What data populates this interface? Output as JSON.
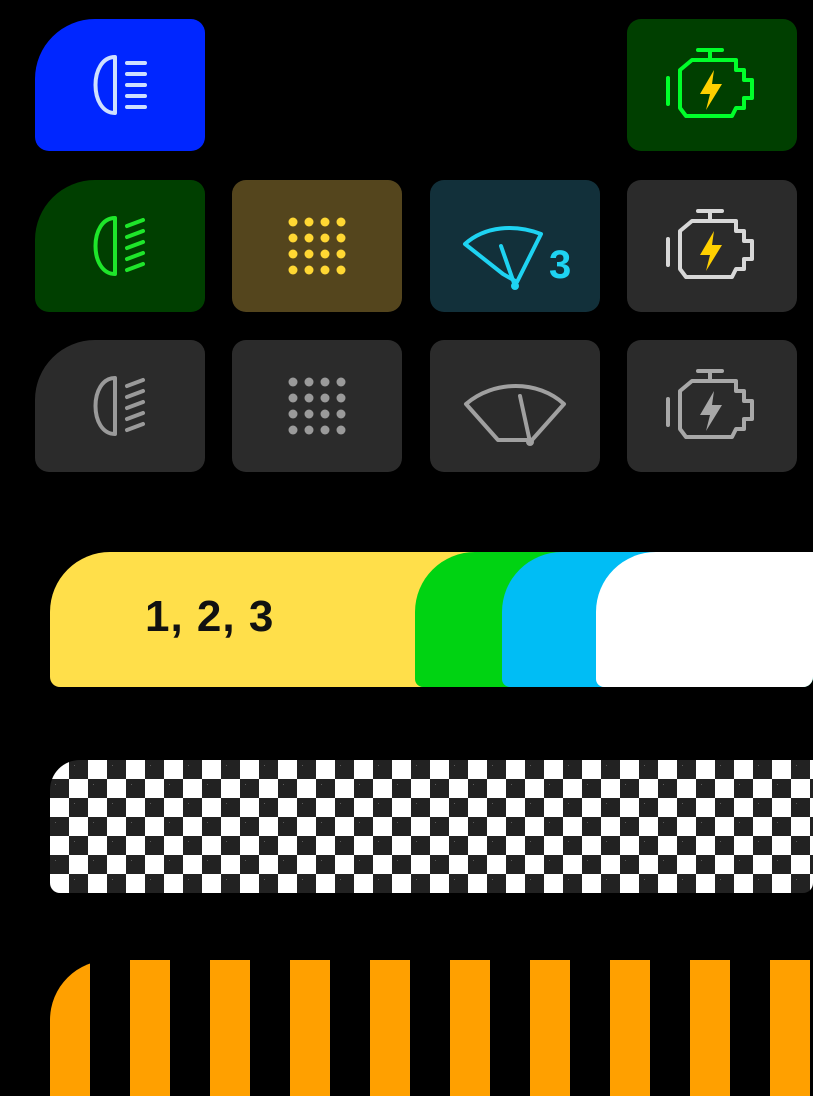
{
  "icons": {
    "row1": [
      {
        "name": "low-beam-headlight-icon",
        "bg": "#0026ff",
        "stroke": "#cfe0ff"
      },
      {
        "name": "check-engine-icon",
        "bg": "#003f00",
        "stroke": "#00ff2a",
        "bolt": "#ffd000"
      }
    ],
    "row2": [
      {
        "name": "fog-light-icon",
        "bg": "#003f00",
        "stroke": "#1ee62a"
      },
      {
        "name": "dot-grid-icon",
        "bg": "#54451d",
        "stroke": "#ffd733"
      },
      {
        "name": "wiper-icon",
        "bg": "#12303a",
        "stroke": "#1ed3f2",
        "badge": "3"
      },
      {
        "name": "check-engine-icon",
        "bg": "#2b2b2b",
        "stroke": "#d8d8d8",
        "bolt": "#ffd000"
      }
    ],
    "row3": [
      {
        "name": "fog-light-icon",
        "bg": "#2b2b2b",
        "stroke": "#9a9a9a"
      },
      {
        "name": "dot-grid-icon",
        "bg": "#2b2b2b",
        "stroke": "#9a9a9a"
      },
      {
        "name": "wiper-icon",
        "bg": "#2b2b2b",
        "stroke": "#a0a0a0"
      },
      {
        "name": "check-engine-icon",
        "bg": "#2b2b2b",
        "stroke": "#a8a8a8",
        "bolt": "#a8a8a8"
      }
    ]
  },
  "bars": {
    "stages": {
      "label": "1, 2, 3",
      "colors": [
        "#ffdf4a",
        "#00d312",
        "#00bdf5",
        "#ffffff"
      ]
    },
    "checker": {
      "colors": [
        "#222222",
        "#ffffff"
      ]
    },
    "stripes": {
      "colors": [
        "#ffa000",
        "#000000"
      ]
    }
  }
}
